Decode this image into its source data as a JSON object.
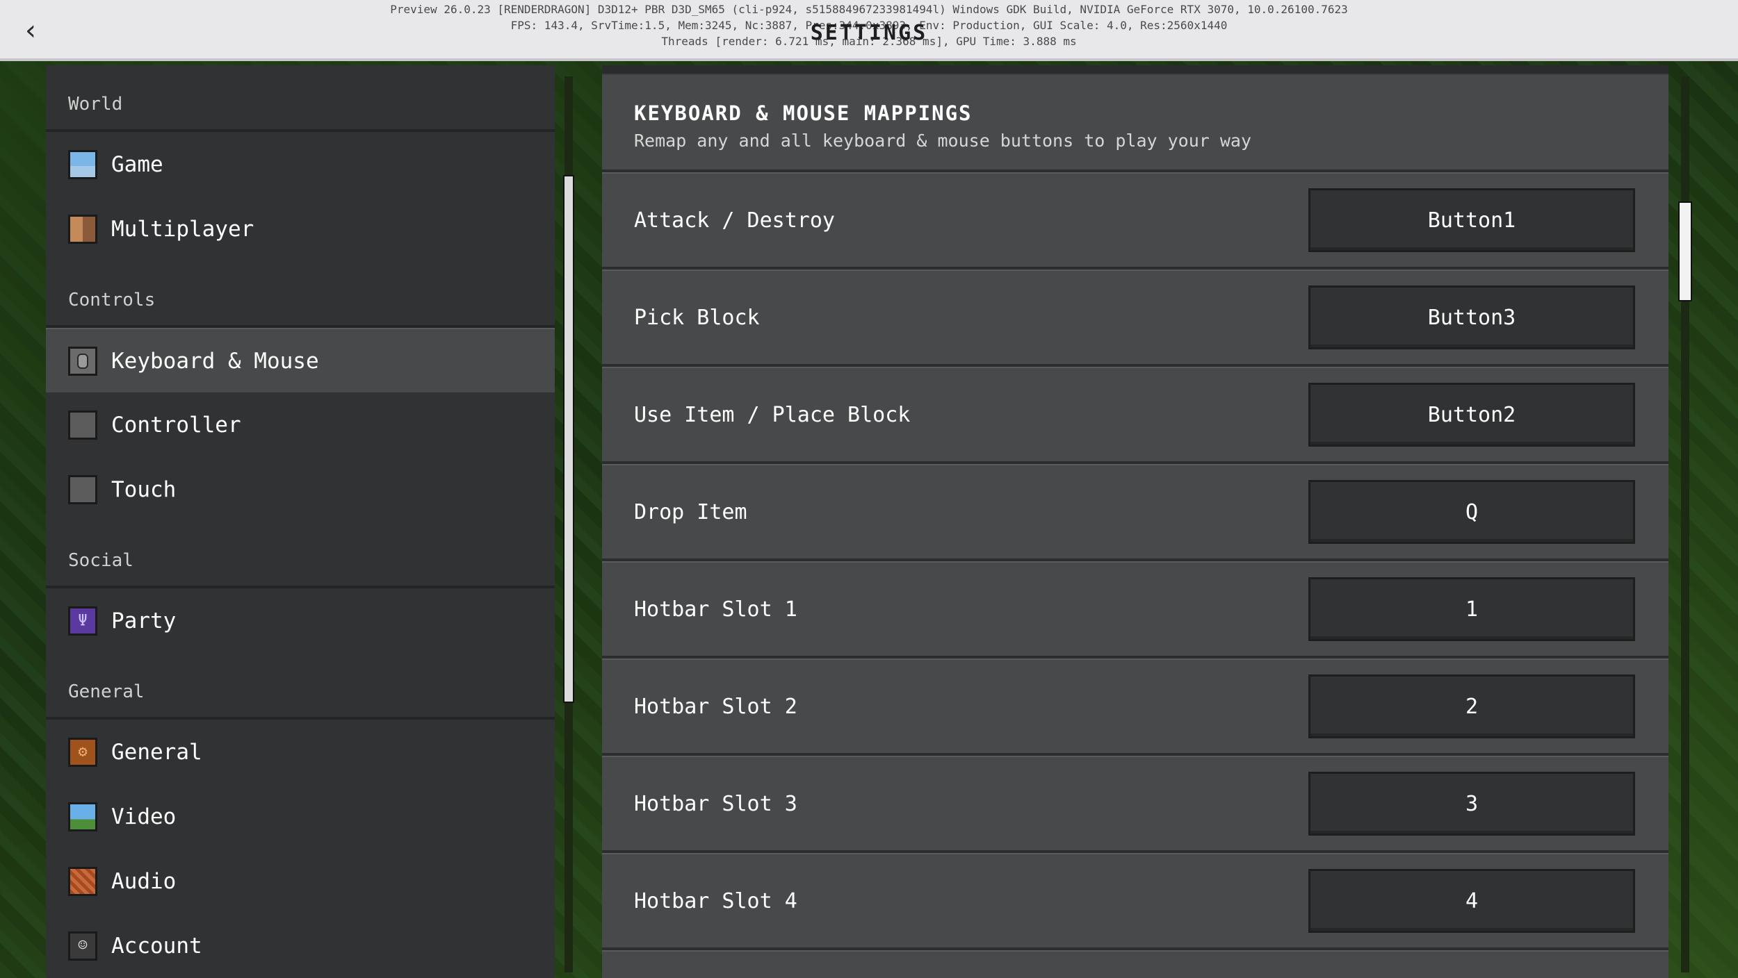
{
  "header": {
    "title": "SETTINGS",
    "back_icon": "chevron-left-icon",
    "debug_lines": [
      "Preview 26.0.23 [RENDERDRAGON] D3D12+ PBR D3D_SM65 (cli-p924, s515884967233981494l) Windows GDK Build, NVIDIA GeForce RTX 3070, 10.0.26100.7623",
      "FPS: 143.4, SrvTime:1.5, Mem:3245, Nc:3887, Pres:344.0x3893, Env: Production, GUI Scale: 4.0, Res:2560x1440",
      "Threads [render: 6.721 ms, main: 2.368 ms], GPU Time: 3.888 ms"
    ]
  },
  "sidebar": {
    "sections": [
      {
        "label": "World",
        "items": [
          {
            "label": "Game",
            "icon": "game-icon"
          },
          {
            "label": "Multiplayer",
            "icon": "multiplayer-icon"
          }
        ]
      },
      {
        "label": "Controls",
        "items": [
          {
            "label": "Keyboard & Mouse",
            "icon": "mouse-icon",
            "selected": true
          },
          {
            "label": "Controller",
            "icon": "controller-icon"
          },
          {
            "label": "Touch",
            "icon": "touch-icon"
          }
        ]
      },
      {
        "label": "Social",
        "items": [
          {
            "label": "Party",
            "icon": "party-icon"
          }
        ]
      },
      {
        "label": "General",
        "items": [
          {
            "label": "General",
            "icon": "gear-icon"
          },
          {
            "label": "Video",
            "icon": "video-icon"
          },
          {
            "label": "Audio",
            "icon": "audio-icon"
          },
          {
            "label": "Account",
            "icon": "account-icon"
          }
        ]
      }
    ]
  },
  "main": {
    "section_title": "KEYBOARD & MOUSE MAPPINGS",
    "section_subtitle": "Remap any and all keyboard & mouse buttons to play your way",
    "mappings": [
      {
        "action": "Attack / Destroy",
        "key": "Button1"
      },
      {
        "action": "Pick Block",
        "key": "Button3"
      },
      {
        "action": "Use Item / Place Block",
        "key": "Button2"
      },
      {
        "action": "Drop Item",
        "key": "Q"
      },
      {
        "action": "Hotbar Slot 1",
        "key": "1"
      },
      {
        "action": "Hotbar Slot 2",
        "key": "2"
      },
      {
        "action": "Hotbar Slot 3",
        "key": "3"
      },
      {
        "action": "Hotbar Slot 4",
        "key": "4"
      }
    ]
  }
}
